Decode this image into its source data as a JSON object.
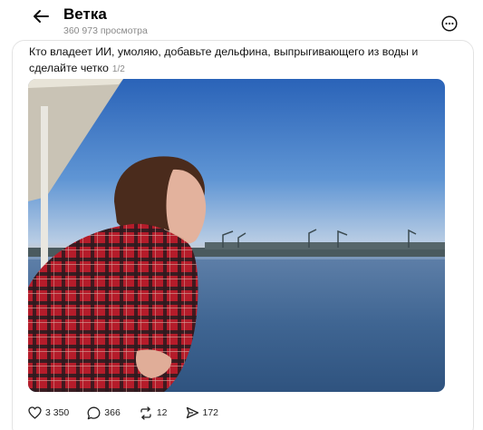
{
  "header": {
    "title": "Ветка",
    "views": "360 973 просмотра"
  },
  "post": {
    "text": "Кто владеет ИИ, умоляю, добавьте дельфина, выпрыгивающего из воды и сделайте четко",
    "page_indicator": "1/2"
  },
  "actions": {
    "likes": "3 350",
    "replies": "366",
    "reposts": "12",
    "shares": "172"
  },
  "icons": {
    "back": "arrow-left-icon",
    "more": "more-circle-icon",
    "like": "heart-icon",
    "reply": "comment-icon",
    "repost": "repost-icon",
    "share": "send-icon"
  }
}
